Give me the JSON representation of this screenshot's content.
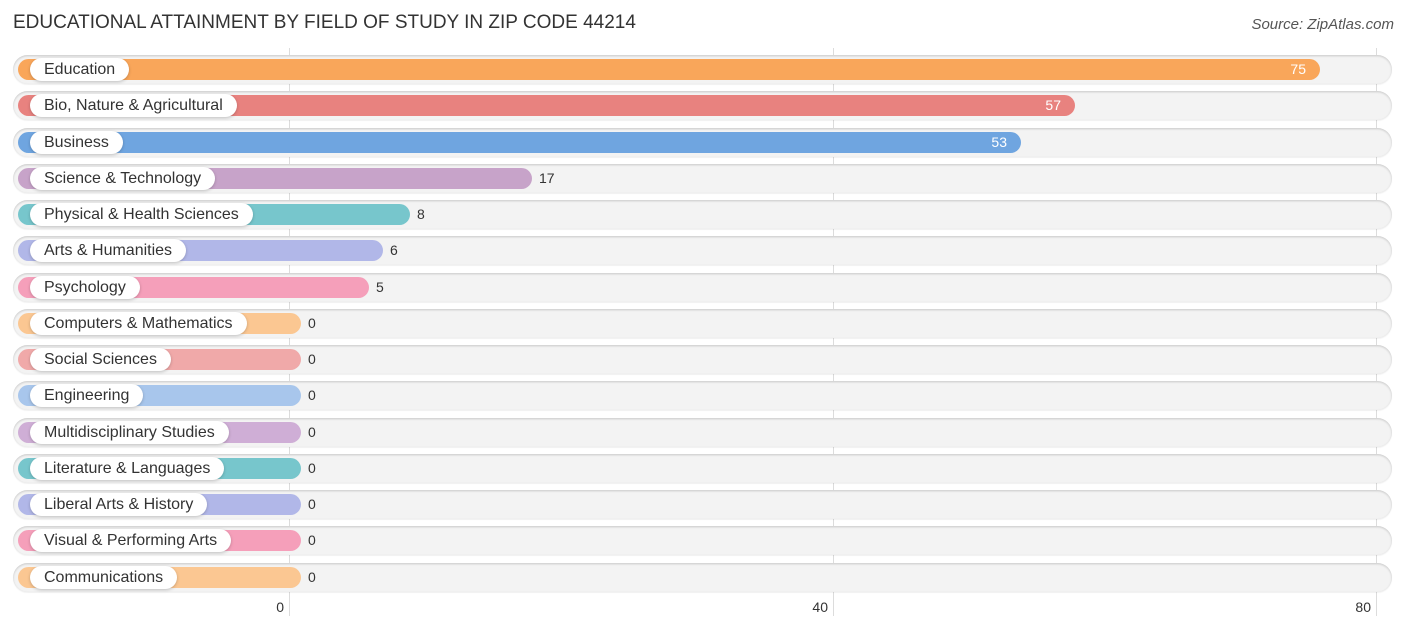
{
  "chart_data": {
    "type": "bar",
    "orientation": "horizontal",
    "title": "EDUCATIONAL ATTAINMENT BY FIELD OF STUDY IN ZIP CODE 44214",
    "source": "Source: ZipAtlas.com",
    "xlabel": "",
    "ylabel": "",
    "xlim": [
      0,
      80
    ],
    "ticks": [
      0,
      40,
      80
    ],
    "tick_labels": [
      "0",
      "40",
      "80"
    ],
    "grid": true,
    "categories": [
      "Education",
      "Bio, Nature & Agricultural",
      "Business",
      "Science & Technology",
      "Physical & Health Sciences",
      "Arts & Humanities",
      "Psychology",
      "Computers & Mathematics",
      "Social Sciences",
      "Engineering",
      "Multidisciplinary Studies",
      "Literature & Languages",
      "Liberal Arts & History",
      "Visual & Performing Arts",
      "Communications"
    ],
    "values": [
      75,
      57,
      53,
      17,
      8,
      6,
      5,
      0,
      0,
      0,
      0,
      0,
      0,
      0,
      0
    ],
    "value_labels": [
      "75",
      "57",
      "53",
      "17",
      "8",
      "6",
      "5",
      "0",
      "0",
      "0",
      "0",
      "0",
      "0",
      "0",
      "0"
    ],
    "colors": [
      "#f9a65a",
      "#e8827f",
      "#6fa5e0",
      "#c7a3c9",
      "#77c6cc",
      "#b1b7e8",
      "#f59fba",
      "#fbc792",
      "#f0a9a9",
      "#a8c6ec",
      "#cfaed6",
      "#77c6cc",
      "#b1b7e8",
      "#f59fba",
      "#fbc792"
    ]
  }
}
